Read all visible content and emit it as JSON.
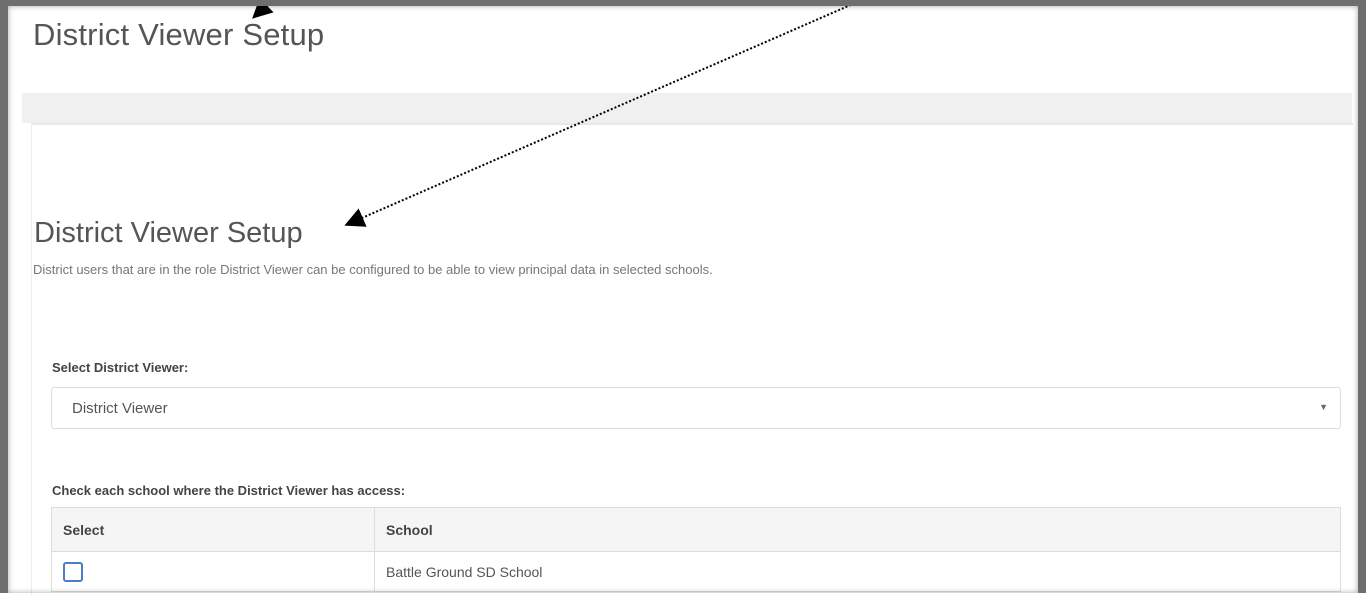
{
  "page": {
    "title": "District Viewer Setup"
  },
  "section": {
    "title": "District Viewer Setup",
    "description": "District users that are in the role District Viewer can be configured to be able to view principal data in selected schools."
  },
  "district_viewer_select": {
    "label": "Select District Viewer:",
    "selected": "District Viewer",
    "caret_icon": "caret-down-icon"
  },
  "schools_table": {
    "label": "Check each school where the District Viewer has access:",
    "headers": [
      "Select",
      "School"
    ],
    "rows": [
      {
        "checked": false,
        "school": "Battle Ground SD School"
      }
    ]
  },
  "annotation": {
    "color": "#000000"
  }
}
